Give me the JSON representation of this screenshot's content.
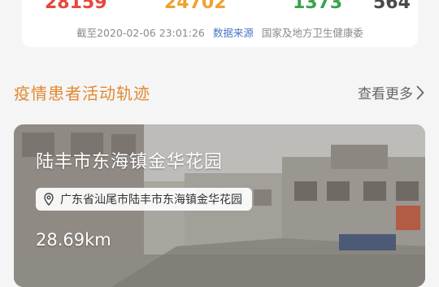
{
  "stats": {
    "confirmed": "28159",
    "suspected": "24702",
    "cured": "1373",
    "dead": "564"
  },
  "asof": {
    "prefix": "截至2020-02-06 23:01:26",
    "source_link": "数据来源",
    "source_name": "国家及地方卫生健康委"
  },
  "section": {
    "title": "疫情患者活动轨迹",
    "more": "查看更多"
  },
  "track": {
    "place": "陆丰市东海镇金华花园",
    "address": "广东省汕尾市陆丰市东海镇金华花园",
    "distance": "28.69km"
  },
  "colors": {
    "confirmed": "#e8463c",
    "suspected": "#f0a22e",
    "cured": "#3aa34a",
    "dead": "#4a4a4a",
    "section_title": "#e2892f",
    "link": "#4a74c9"
  },
  "icons": {
    "more": "chevron-right-icon",
    "address": "location-pin-icon"
  }
}
